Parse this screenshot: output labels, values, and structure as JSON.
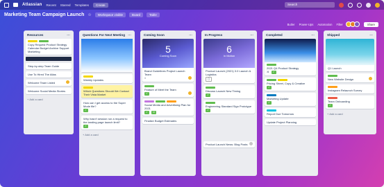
{
  "topnav": {
    "brand": "Atlassian",
    "items": [
      "Recent",
      "Starred",
      "Templates",
      "Create"
    ],
    "search": "Search"
  },
  "board": {
    "title": "Marketing Team Campaign Launch",
    "buttons": [
      "Workspace visible",
      "Board",
      "Table"
    ],
    "subbar": [
      "Butler",
      "Power-Ups",
      "Automation",
      "Filter"
    ],
    "share": "Share"
  },
  "lists": [
    {
      "title": "Resources",
      "cards": [
        {
          "text": "Copy Request  Product Strategy  Calendar  Budget  Archive  Support  Marketing",
          "labels": [
            "yellow",
            "green"
          ]
        },
        {
          "text": "Step-by-step Team Guide",
          "labels": []
        },
        {
          "text": "Use To Hired The Atlas",
          "labels": []
        },
        {
          "text": "Welcome  Team Listed",
          "labels": []
        },
        {
          "text": "Welcome  Social Media Stories",
          "labels": []
        }
      ],
      "add": "+ Add a card"
    },
    {
      "title": "Questions For Next Meeting",
      "cards": [
        {
          "text": "Weekly Updates",
          "labels": [
            "yellow"
          ]
        },
        {
          "text": "Which Questions Should We Contact Their Vista Market",
          "labels": [
            "yellow"
          ],
          "highlight": true
        },
        {
          "text": "How can I get access to the Super Mode file?",
          "labels": []
        },
        {
          "text": "Why hasn't session run a request to the landing page launch limit?",
          "labels": []
        }
      ],
      "add": "+ Add a card"
    },
    {
      "title": "Coming Soon",
      "cover": {
        "num": "5",
        "sub": "Coming Soon"
      },
      "cards": [
        {
          "text": "Brand Guidelines Project Launch Team",
          "labels": []
        },
        {
          "text": "Feature of Meet the Team",
          "labels": [
            "green"
          ]
        },
        {
          "text": "Social Media and Advertising Plan for 2021",
          "labels": [
            "purple",
            "green",
            "orange"
          ]
        },
        {
          "text": "Finalize Budget Estimates",
          "labels": []
        }
      ],
      "add": "+ Add a card"
    },
    {
      "title": "In Progress",
      "cover": {
        "num": "6",
        "sub": "In Motion"
      },
      "cards": [
        {
          "text": "Product Launch (2021) 3.0 Launch & Logistics",
          "labels": []
        },
        {
          "text": "Discuss Launch New Timing",
          "labels": [
            "green"
          ]
        },
        {
          "text": "Engineering Standard Sign Prototype",
          "labels": [
            "green"
          ]
        },
        {
          "text": "Product Launch News: Blog Posts",
          "labels": []
        }
      ],
      "add": "+ Add a card"
    },
    {
      "title": "Completed",
      "cards": [
        {
          "text": "2021 Q4 Product Strategy",
          "labels": [
            "green"
          ]
        },
        {
          "text": "Pricing Sheet, Copy & Creative",
          "labels": [
            "green",
            "yellow"
          ]
        },
        {
          "text": "Marketing Update",
          "labels": [
            "blue"
          ]
        },
        {
          "text": "Report Due Tomorrow",
          "labels": [
            "sky"
          ]
        },
        {
          "text": "Update Project Planning",
          "labels": []
        }
      ],
      "add": "+ Add a card"
    },
    {
      "title": "Shipped",
      "cards": [
        {
          "text": "Q1 Launch",
          "labels": []
        },
        {
          "text": "New Website Design",
          "labels": [
            "green"
          ]
        },
        {
          "text": "Instagram Relaunch Survey",
          "labels": [
            "orange"
          ]
        },
        {
          "text": "Team Onboarding",
          "labels": [
            "red"
          ]
        }
      ],
      "add": "+ Add a card"
    }
  ],
  "colors": {
    "bg_start": "#3a4fd8",
    "bg_end": "#d43fb0",
    "list_bg": "#ebecf0",
    "label_green": "#61bd4f",
    "label_yellow": "#f2d600"
  }
}
